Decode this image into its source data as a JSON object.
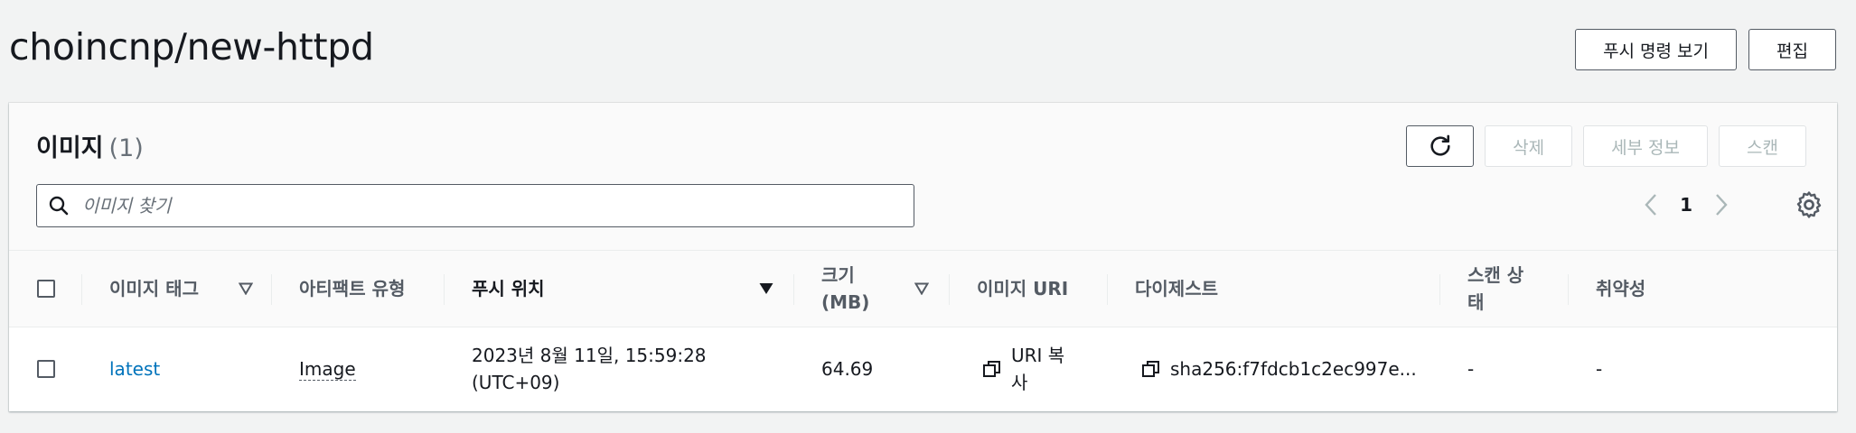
{
  "page": {
    "title": "choincnp/new-httpd",
    "actions": {
      "push_commands": "푸시 명령 보기",
      "edit": "편집"
    }
  },
  "images_panel": {
    "title": "이미지",
    "count": "(1)",
    "actions": {
      "delete": "삭제",
      "details": "세부 정보",
      "scan": "스캔"
    },
    "search": {
      "placeholder": "이미지 찾기",
      "value": ""
    },
    "pagination": {
      "current_page": "1"
    }
  },
  "table": {
    "columns": {
      "image_tag": "이미지 태그",
      "artifact_type": "아티팩트 유형",
      "pushed_at": "푸시 위치",
      "size": "크기 (MB)",
      "image_uri": "이미지 URI",
      "digest": "다이제스트",
      "scan_status": "스캔 상태",
      "vulnerabilities": "취약성"
    },
    "rows": [
      {
        "image_tag": "latest",
        "artifact_type": "Image",
        "pushed_at": "2023년 8월 11일, 15:59:28 (UTC+09)",
        "size": "64.69",
        "image_uri": "URI 복사",
        "digest": "sha256:f7fdcb1c2ec997e...",
        "scan_status": "-",
        "vulnerabilities": "-"
      }
    ]
  },
  "icons": {
    "refresh": "refresh-icon",
    "search": "search-icon",
    "prev": "chevron-left-icon",
    "next": "chevron-right-icon",
    "settings": "gear-icon",
    "sort": "sort-triangle-icon",
    "copy": "copy-icon"
  },
  "colors": {
    "link": "#0073bb",
    "background": "#f2f3f3",
    "border": "#545b64",
    "disabled": "#aab7b8"
  }
}
